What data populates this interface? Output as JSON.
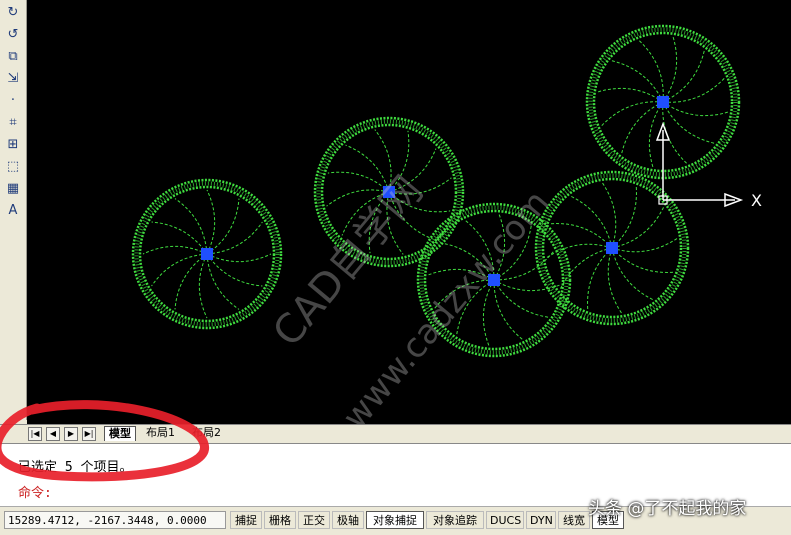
{
  "toolbar": {
    "tools": [
      {
        "name": "rotate-icon",
        "glyph": "↻"
      },
      {
        "name": "undo-arc-icon",
        "glyph": "↺"
      },
      {
        "name": "scale-icon",
        "glyph": "⧉"
      },
      {
        "name": "stretch-icon",
        "glyph": "⇲"
      },
      {
        "name": "point-icon",
        "glyph": "·"
      },
      {
        "name": "trim-icon",
        "glyph": "⌗"
      },
      {
        "name": "extend-icon",
        "glyph": "⊞"
      },
      {
        "name": "break-icon",
        "glyph": "⬚"
      },
      {
        "name": "table-icon",
        "glyph": "▦"
      },
      {
        "name": "text-icon",
        "glyph": "A"
      }
    ]
  },
  "drawing": {
    "circle_color": "#3fdc3f",
    "center_color": "#1f4fff",
    "ucs_x_label": "X"
  },
  "watermark": {
    "text1": "CAD自学网",
    "text2": "www.cadzxw.com"
  },
  "tabs": {
    "nav": [
      "|◀",
      "◀",
      "▶",
      "▶|"
    ],
    "items": [
      {
        "label": "模型",
        "active": true
      },
      {
        "label": "布局1",
        "active": false
      },
      {
        "label": "布局2",
        "active": false
      }
    ]
  },
  "command": {
    "history": "已选定 5 个项目。",
    "prompt": "命令:",
    "prompt_color": "#cc2222"
  },
  "status": {
    "coords": "15289.4712,  -2167.3448, 0.0000",
    "buttons": [
      {
        "label": "捕捉",
        "on": false
      },
      {
        "label": "栅格",
        "on": false
      },
      {
        "label": "正交",
        "on": false
      },
      {
        "label": "极轴",
        "on": false
      },
      {
        "label": "对象捕捉",
        "on": true
      },
      {
        "label": "对象追踪",
        "on": false
      },
      {
        "label": "DUCS",
        "on": false
      },
      {
        "label": "DYN",
        "on": false
      },
      {
        "label": "线宽",
        "on": false
      },
      {
        "label": "模型",
        "on": true
      }
    ]
  },
  "overlay": {
    "logo_text": "头条 @了不起我的家"
  }
}
